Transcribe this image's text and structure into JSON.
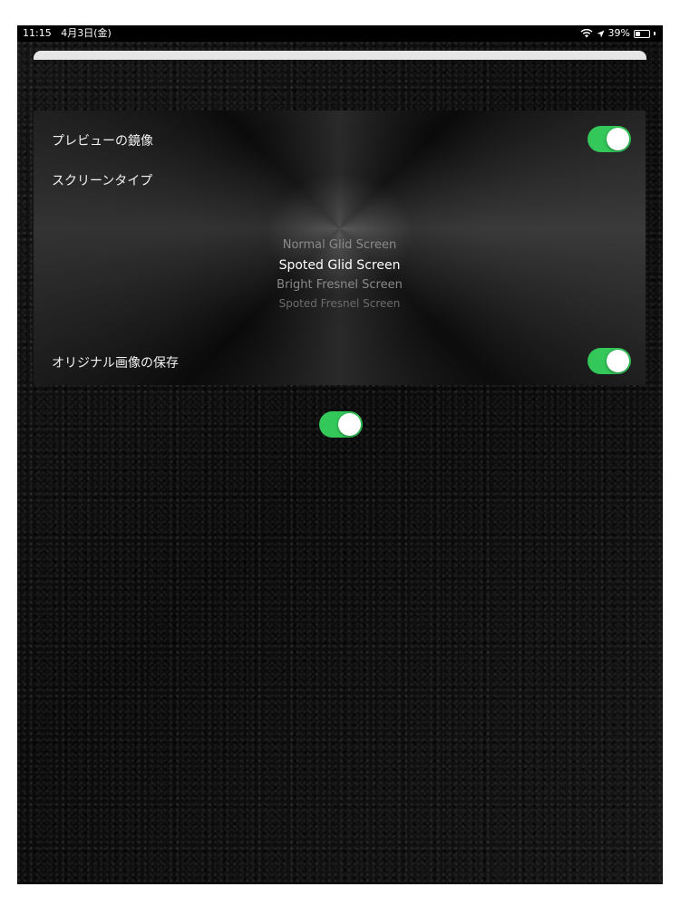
{
  "status_bar": {
    "time": "11:15",
    "date": "4月3日(金)",
    "battery_percent": "39%",
    "battery_level": 0.39
  },
  "settings": {
    "mirror_preview": {
      "label": "プレビューの鏡像",
      "on": true
    },
    "screen_type": {
      "label": "スクリーンタイプ",
      "options": [
        "Normal Glid Screen",
        "Spoted Glid Screen",
        "Bright Fresnel Screen",
        "Spoted Fresnel Screen"
      ],
      "selected": "Spoted Glid Screen"
    },
    "save_original": {
      "label": "オリジナル画像の保存",
      "on": true
    }
  },
  "extra_toggle": {
    "on": true
  },
  "colors": {
    "toggle_on": "#34c759",
    "background": "#101010",
    "text": "#f2f2f2"
  }
}
